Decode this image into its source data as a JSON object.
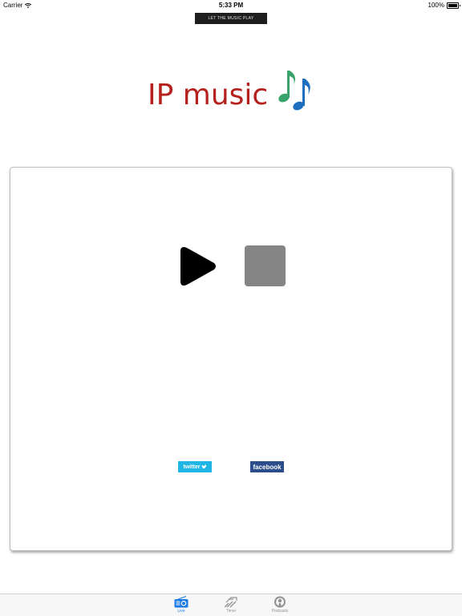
{
  "status_bar": {
    "carrier": "Carrier",
    "time": "5:33 PM",
    "battery": "100%"
  },
  "banner": {
    "text": "LET THE MUSIC PLAY"
  },
  "logo": {
    "text": "IP music",
    "icon": "music-notes-icon",
    "text_color": "#b5221e"
  },
  "player": {
    "play_icon": "play-icon",
    "stop_icon": "stop-icon"
  },
  "social": {
    "twitter_label": "twitter",
    "twitter_color": "#1fb6e6",
    "facebook_label": "facebook",
    "facebook_color": "#2c4d8c"
  },
  "tabs": [
    {
      "label": "Live",
      "icon": "radio-icon",
      "active": true
    },
    {
      "label": "Timer",
      "icon": "timer-icon",
      "active": false
    },
    {
      "label": "Podcasts",
      "icon": "podcast-icon",
      "active": false
    }
  ],
  "colors": {
    "active_tab": "#1a7be8",
    "inactive_tab": "#929292"
  }
}
